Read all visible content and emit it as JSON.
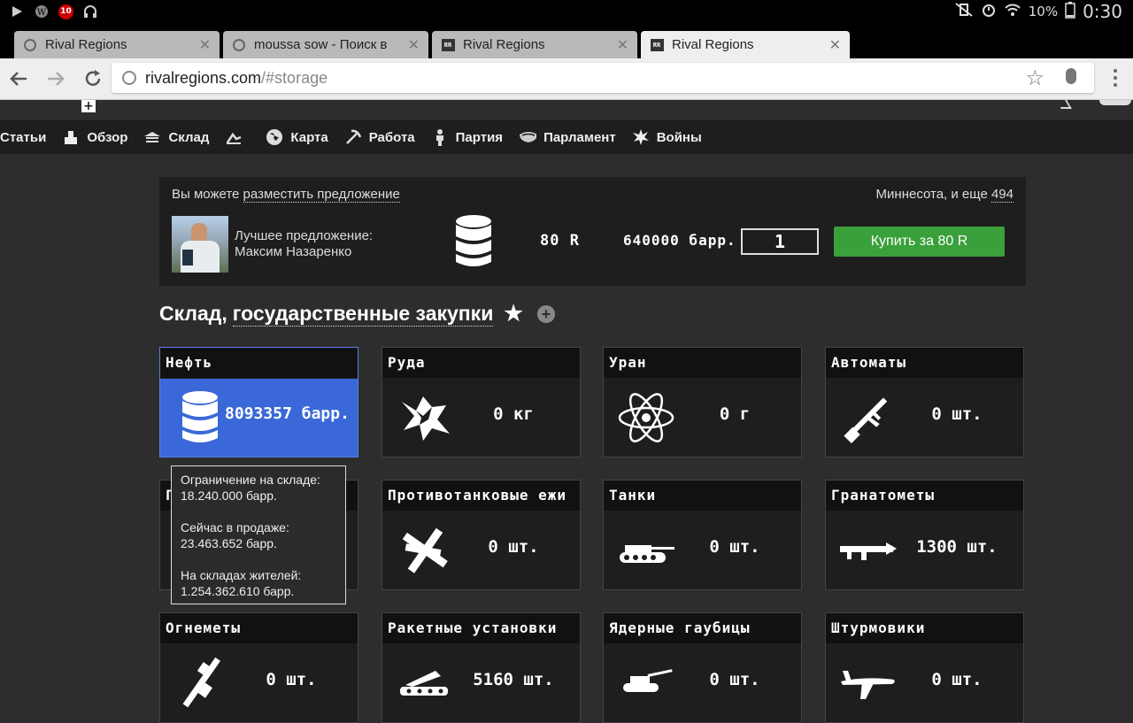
{
  "statusbar": {
    "battery_pct": "10%",
    "time": "0:30",
    "notif_count": "10"
  },
  "tabs": [
    {
      "title": "Rival Regions",
      "favicon": "globe-icon",
      "active": false
    },
    {
      "title": "moussa sow - Поиск в",
      "favicon": "globe-icon",
      "active": false
    },
    {
      "title": "Rival Regions",
      "favicon": "rr-icon",
      "active": false
    },
    {
      "title": "Rival Regions",
      "favicon": "rr-icon",
      "active": true
    }
  ],
  "omnibox": {
    "host": "rivalregions.com",
    "path": "/#storage"
  },
  "nav": [
    {
      "label": "Статьи",
      "icon": ""
    },
    {
      "label": "Обзор",
      "icon": "overview-icon"
    },
    {
      "label": "Склад",
      "icon": "storage-icon"
    },
    {
      "label": "",
      "icon": "walk-icon"
    },
    {
      "label": "Карта",
      "icon": "globe-icon"
    },
    {
      "label": "Работа",
      "icon": "pickaxe-icon"
    },
    {
      "label": "Партия",
      "icon": "party-icon"
    },
    {
      "label": "Парламент",
      "icon": "parliament-icon"
    },
    {
      "label": "Войны",
      "icon": "explosion-icon"
    }
  ],
  "market": {
    "prefix": "Вы можете",
    "offer_link": "разместить предложение",
    "region_text": "Миннесота, и еще",
    "region_count": "494",
    "best_label": "Лучшее предложение:",
    "best_name": "Максим Назаренко",
    "price": "80 R",
    "amount": "640000 барр.",
    "quantity": "1",
    "buy_label": "Купить за 80 R"
  },
  "heading": {
    "prefix": "Склад,",
    "link": "государственные закупки"
  },
  "resources": [
    {
      "name": "Нефть",
      "value": "8093357 барр.",
      "icon": "barrel-icon",
      "selected": true
    },
    {
      "name": "Руда",
      "value": "0 кг",
      "icon": "ore-icon"
    },
    {
      "name": "Уран",
      "value": "0 г",
      "icon": "atom-icon"
    },
    {
      "name": "Автоматы",
      "value": "0 шт.",
      "icon": "rifle-icon"
    },
    {
      "name": "Г",
      "value": "",
      "icon": ""
    },
    {
      "name": "Противотанковые ежи",
      "value": "0 шт.",
      "icon": "hedgehog-icon"
    },
    {
      "name": "Танки",
      "value": "0 шт.",
      "icon": "tank-icon"
    },
    {
      "name": "Гранатометы",
      "value": "1300 шт.",
      "icon": "rpg-icon"
    },
    {
      "name": "Огнеметы",
      "value": "0 шт.",
      "icon": "flamethrower-icon"
    },
    {
      "name": "Ракетные установки",
      "value": "5160 шт.",
      "icon": "rocket-launcher-icon"
    },
    {
      "name": "Ядерные гаубицы",
      "value": "0 шт.",
      "icon": "howitzer-icon"
    },
    {
      "name": "Штурмовики",
      "value": "0 шт.",
      "icon": "plane-icon"
    }
  ],
  "tooltip": {
    "limit_label": "Ограничение на складе:",
    "limit_value": "18.240.000 барр.",
    "sale_label": "Сейчас в продаже:",
    "sale_value": "23.463.652 барр.",
    "residents_label": "На складах жителей:",
    "residents_value": "1.254.362.610 барр."
  },
  "colors": {
    "buy_green": "#3aa03c",
    "selected_blue": "#3a68d8",
    "panel": "#1e1e1e",
    "page": "#2d2d2d"
  }
}
